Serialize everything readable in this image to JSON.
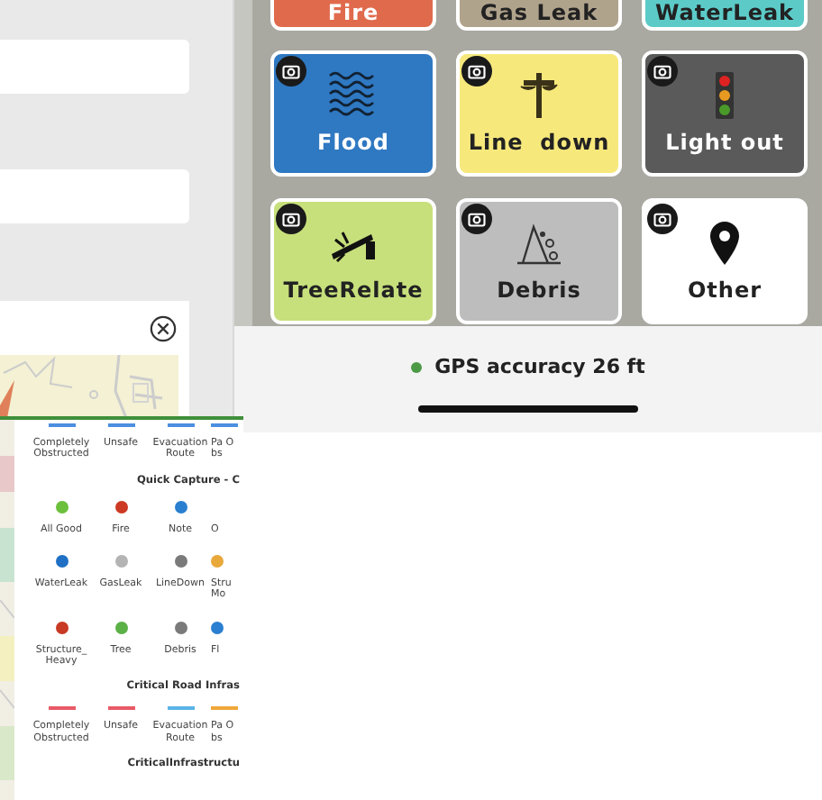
{
  "tiles": [
    {
      "label": "Fire",
      "color": "#e06a4c",
      "kind": "plain"
    },
    {
      "label": "Gas Leak",
      "color": "#b0a38c",
      "kind": "plain"
    },
    {
      "label": "WaterLeak",
      "color": "#5ccbc8",
      "kind": "plain"
    },
    {
      "label": "Flood",
      "color": "#2f78c2",
      "kind": "waves"
    },
    {
      "label": "Line  down",
      "color": "#f7e87c",
      "kind": "pole"
    },
    {
      "label": "Light out",
      "color": "#5a5a5a",
      "kind": "signal"
    },
    {
      "label": "TreeRelate",
      "color": "#c7e07c",
      "kind": "tree"
    },
    {
      "label": "Debris",
      "color": "#bdbdbd",
      "kind": "debris"
    },
    {
      "label": "Other",
      "color": "#ffffff",
      "kind": "pin"
    }
  ],
  "gps": {
    "text": "GPS accuracy 26 ft",
    "color": "#4c9a46"
  },
  "legend": [
    {
      "kind": "lines",
      "items": [
        {
          "label": "Completely Obstructed",
          "color": "#4a8fe0"
        },
        {
          "label": "Unsafe",
          "color": "#4a8fe0"
        },
        {
          "label": "Evacuation Route",
          "color": "#4a8fe0"
        },
        {
          "label": "Pa Obs",
          "color": "#4a8fe0"
        }
      ]
    },
    {
      "kind": "heading",
      "text": "Quick Capture - C"
    },
    {
      "kind": "icons",
      "items": [
        {
          "label": "All Good",
          "color": "#6cc03c"
        },
        {
          "label": "Fire",
          "color": "#cc3a24"
        },
        {
          "label": "Note",
          "color": "#2a7fd0"
        },
        {
          "label": "O"
        }
      ]
    },
    {
      "kind": "icons",
      "items": [
        {
          "label": "WaterLeak",
          "color": "#1f70c4"
        },
        {
          "label": "GasLeak",
          "color": "#b4b4b4"
        },
        {
          "label": "LineDown",
          "color": "#7a7a7a"
        },
        {
          "label": "Stru Mo",
          "color": "#e8a83a"
        }
      ]
    },
    {
      "kind": "icons",
      "items": [
        {
          "label": "Structure_Heavy",
          "color": "#c83a24"
        },
        {
          "label": "Tree",
          "color": "#5cb048"
        },
        {
          "label": "Debris",
          "color": "#7a7a7a"
        },
        {
          "label": "Fl",
          "color": "#2a7fd0"
        }
      ]
    },
    {
      "kind": "heading",
      "text": "Critical Road Infras"
    },
    {
      "kind": "lines",
      "items": [
        {
          "label": "Completely Obstructed",
          "color": "#e85a66"
        },
        {
          "label": "Unsafe",
          "color": "#e85a66"
        },
        {
          "label": "Evacuation Route",
          "color": "#5ab4e6"
        },
        {
          "label": "Pa Obs",
          "color": "#f0a83a"
        }
      ]
    },
    {
      "kind": "heading",
      "text": "CriticalInfrastructu"
    }
  ]
}
